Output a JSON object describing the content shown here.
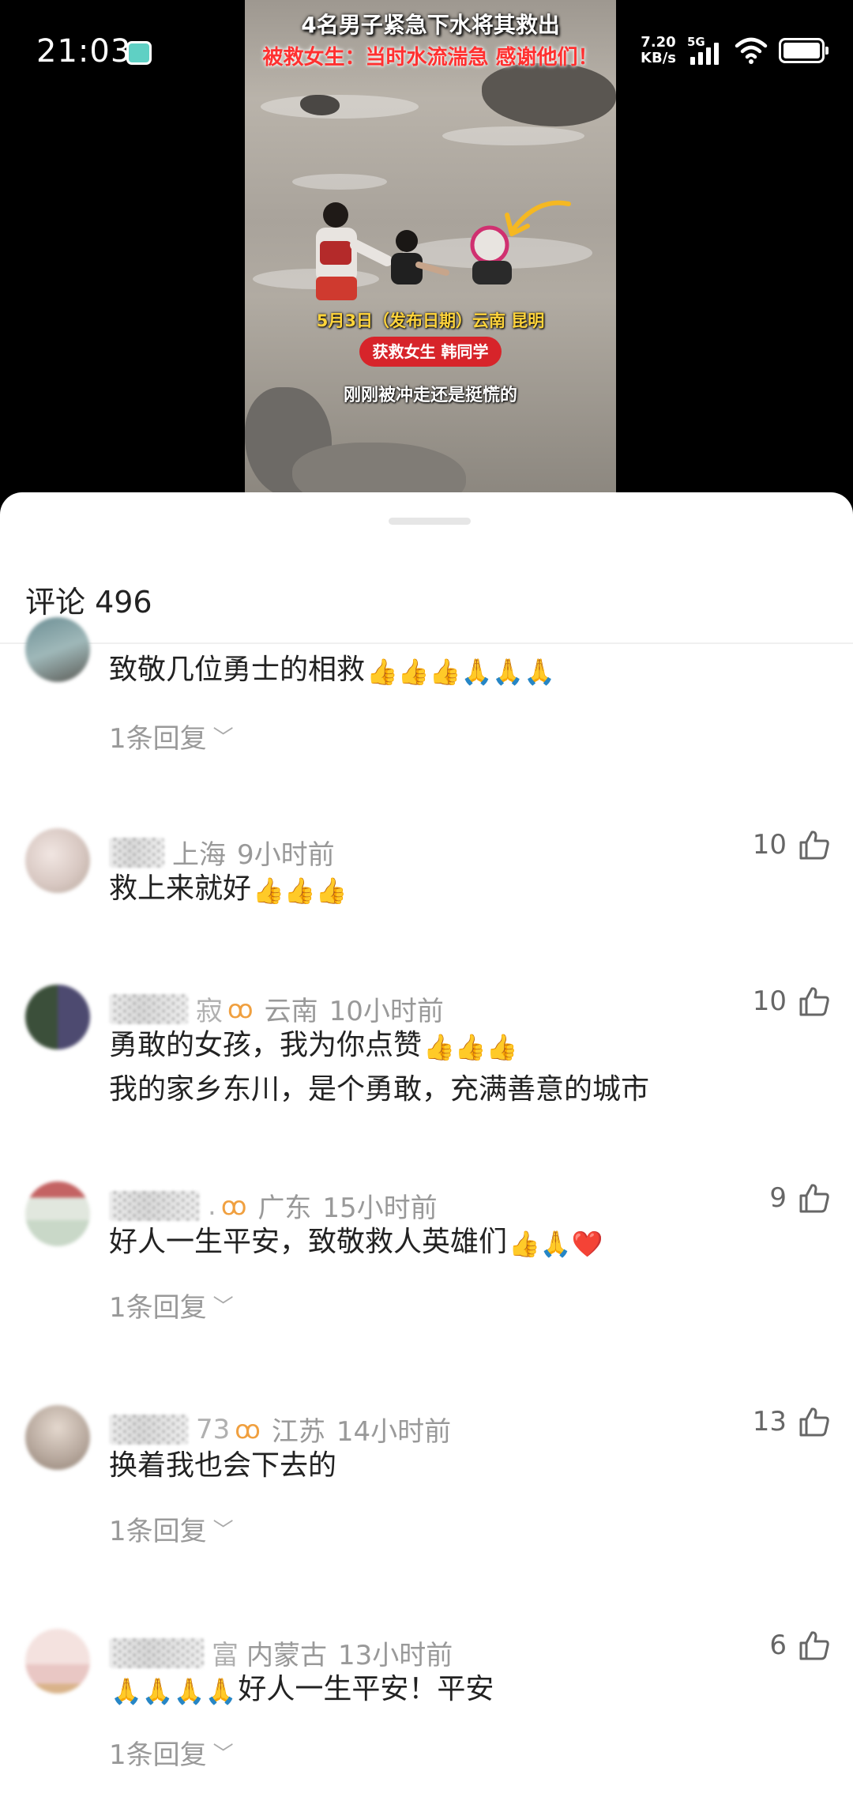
{
  "status_bar": {
    "time": "21:03",
    "net_speed_value": "7.20",
    "net_speed_unit": "KB/s",
    "network": "5G"
  },
  "video": {
    "title_line1": "4名男子紧急下水将其救出",
    "title_line2": "被救女生：当时水流湍急 感谢他们！",
    "date_caption": "5月3日（发布日期）云南 昆明",
    "badge": "获救女生 韩同学",
    "subtitle": "刚刚被冲走还是挺慌的"
  },
  "comments_sheet": {
    "title": "评论 496",
    "comments": [
      {
        "id": "c0",
        "text": "致敬几位勇士的相救",
        "emojis": "👍👍👍🙏🙏🙏",
        "reply": "1条回复",
        "avatar_colors": [
          "#6d8f95",
          "#9fb8b9",
          "#5a5a55"
        ]
      },
      {
        "id": "c1",
        "username": "░░░░░",
        "location": "上海",
        "time": "9小时前",
        "text": "救上来就好",
        "emojis": "👍👍👍",
        "likes": "10",
        "avatar_colors": [
          "#d8c8c2",
          "#e9dcd6",
          "#b7a79c"
        ]
      },
      {
        "id": "c2",
        "username": "░░░░░░░",
        "username_tail": "寂",
        "location": "云南",
        "time": "10小时前",
        "text": "勇敢的女孩，我为你点赞",
        "emojis": "👍👍👍",
        "text2": "我的家乡东川，是个勇敢，充满善意的城市",
        "likes": "10",
        "avatar_colors": [
          "#3b4f3a",
          "#4d4a70",
          "#7b8474"
        ]
      },
      {
        "id": "c3",
        "username": "░░░░░",
        "username_tail": ".",
        "location": "广东",
        "time": "15小时前",
        "text": "好人一生平安，致敬救人英雄们",
        "emojis": "👍🙏❤️",
        "reply": "1条回复",
        "likes": "9",
        "avatar_colors": [
          "#c9d8c8",
          "#e1e7de",
          "#c46363"
        ]
      },
      {
        "id": "c4",
        "username": "░░░░░",
        "username_tail": "73",
        "location": "江苏",
        "time": "14小时前",
        "text": "换着我也会下去的",
        "reply": "1条回复",
        "likes": "13",
        "avatar_colors": [
          "#b6a79c",
          "#d3c6bb",
          "#8f7f72"
        ]
      },
      {
        "id": "c5",
        "username": "░░░░░░",
        "username_tail": "富",
        "location": "内蒙古",
        "time": "13小时前",
        "text": "好人一生平安！平安",
        "emojis_prefix": "🙏🙏🙏🙏",
        "reply": "1条回复",
        "likes": "6",
        "avatar_colors": [
          "#e9c7c4",
          "#f4e2df",
          "#d9b38a"
        ]
      }
    ]
  },
  "icons": {
    "like": "thumbs-up-outline-icon",
    "fan_badge": "infinity-badge-icon",
    "reply_chevron": "chevron-down-icon"
  }
}
